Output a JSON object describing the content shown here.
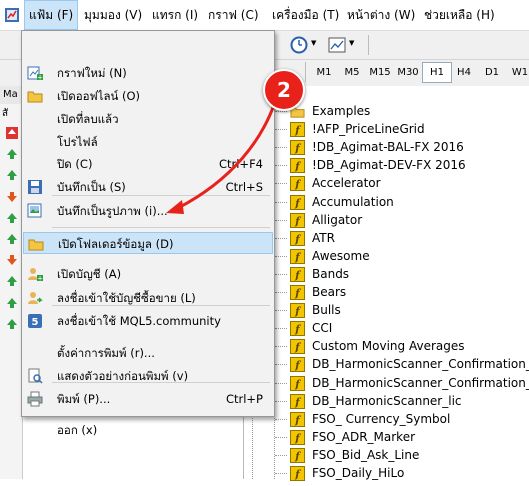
{
  "menubar": {
    "items": [
      {
        "label": "แฟ้ม (F)"
      },
      {
        "label": "มุมมอง (V)"
      },
      {
        "label": "แทรก (I)"
      },
      {
        "label": "กราฟ (C)"
      },
      {
        "label": "เครื่องมือ (T)"
      },
      {
        "label": "หน้าต่าง (W)"
      },
      {
        "label": "ช่วยเหลือ (H)"
      }
    ]
  },
  "timeframes": [
    "M1",
    "M5",
    "M15",
    "M30",
    "H1",
    "H4",
    "D1",
    "W1"
  ],
  "timeframe_selected": "H1",
  "left_pane": {
    "header": "Ma",
    "sub": "สั"
  },
  "file_menu": {
    "items": [
      {
        "label": "กราฟใหม่ (N)",
        "shortcut": "",
        "icon": "new-chart-icon"
      },
      {
        "label": "เปิดออฟไลน์ (O)",
        "shortcut": "",
        "icon": "open-folder-icon"
      },
      {
        "label": "เปิดที่ลบแล้ว",
        "shortcut": "",
        "icon": ""
      },
      {
        "label": "โปรไฟล์",
        "shortcut": "",
        "icon": ""
      },
      {
        "label": "ปิด (C)",
        "shortcut": "Ctrl+F4",
        "icon": ""
      },
      {
        "label": "บันทึกเป็น (S)",
        "shortcut": "Ctrl+S",
        "icon": "save-icon"
      },
      {
        "label": "บันทึกเป็นรูปภาพ (i)...",
        "shortcut": "",
        "icon": "save-picture-icon"
      },
      {
        "label": "เปิดโฟลเดอร์ข้อมูล (D)",
        "shortcut": "",
        "icon": "data-folder-icon"
      },
      {
        "label": "เปิดบัญชี (A)",
        "shortcut": "",
        "icon": "open-account-icon"
      },
      {
        "label": "ลงชื่อเข้าใช้บัญชีซื้อขาย (L)",
        "shortcut": "",
        "icon": "login-trade-icon"
      },
      {
        "label": "ลงชื่อเข้าใช้ MQL5.community",
        "shortcut": "",
        "icon": "mql5-login-icon"
      },
      {
        "label": "ตั้งค่าการพิมพ์ (r)...",
        "shortcut": "",
        "icon": ""
      },
      {
        "label": "แสดงตัวอย่างก่อนพิมพ์ (v)",
        "shortcut": "",
        "icon": "print-preview-icon"
      },
      {
        "label": "พิมพ์ (P)...",
        "shortcut": "Ctrl+P",
        "icon": "print-icon"
      },
      {
        "label": "ออก (x)",
        "shortcut": "",
        "icon": ""
      }
    ]
  },
  "navigator": {
    "items": [
      "Examples",
      "!AFP_PriceLineGrid",
      "!DB_Agimat-BAL-FX 2016",
      "!DB_Agimat-DEV-FX 2016",
      "Accelerator",
      "Accumulation",
      "Alligator",
      "ATR",
      "Awesome",
      "Bands",
      "Bears",
      "Bulls",
      "CCI",
      "Custom Moving Averages",
      "DB_HarmonicScanner_Confirmation_A",
      "DB_HarmonicScanner_Confirmation_B",
      "DB_HarmonicScanner_lic",
      "FSO_ Currency_Symbol",
      "FSO_ADR_Marker",
      "FSO_Bid_Ask_Line",
      "FSO_Daily_HiLo"
    ]
  },
  "annotation": {
    "step": "2",
    "color": "#e8211a"
  },
  "colors": {
    "highlight": "#cce4f7",
    "highlight_border": "#99c9ef",
    "indicator_icon": "#f2c500"
  }
}
